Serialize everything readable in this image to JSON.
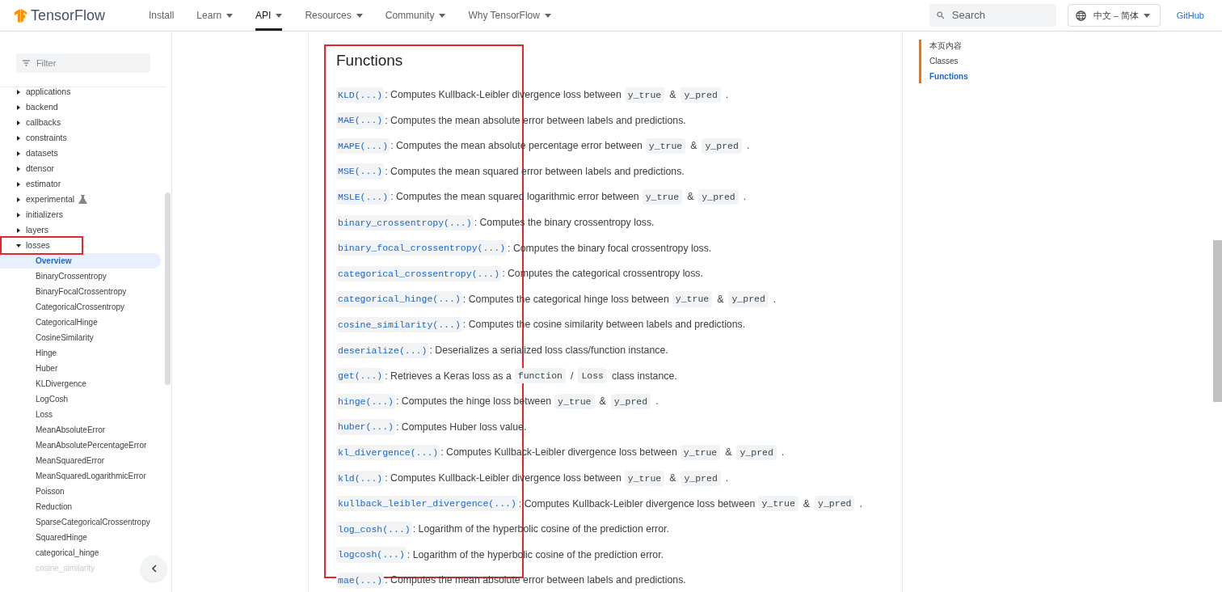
{
  "header": {
    "brand": "TensorFlow",
    "nav": [
      {
        "label": "Install",
        "dropdown": false,
        "selected": false
      },
      {
        "label": "Learn",
        "dropdown": true,
        "selected": false
      },
      {
        "label": "API",
        "dropdown": true,
        "selected": true
      },
      {
        "label": "Resources",
        "dropdown": true,
        "selected": false
      },
      {
        "label": "Community",
        "dropdown": true,
        "selected": false
      },
      {
        "label": "Why TensorFlow",
        "dropdown": true,
        "selected": false
      }
    ],
    "search": {
      "placeholder": "Search"
    },
    "language": "中文 – 简体",
    "github": "GitHub"
  },
  "sidebar": {
    "filter": {
      "placeholder": "Filter"
    },
    "items": [
      {
        "label": "applications",
        "expanded": false,
        "experimental": false,
        "annotated": false
      },
      {
        "label": "backend",
        "expanded": false,
        "experimental": false,
        "annotated": false
      },
      {
        "label": "callbacks",
        "expanded": false,
        "experimental": false,
        "annotated": false
      },
      {
        "label": "constraints",
        "expanded": false,
        "experimental": false,
        "annotated": false
      },
      {
        "label": "datasets",
        "expanded": false,
        "experimental": false,
        "annotated": false
      },
      {
        "label": "dtensor",
        "expanded": false,
        "experimental": false,
        "annotated": false
      },
      {
        "label": "estimator",
        "expanded": false,
        "experimental": false,
        "annotated": false
      },
      {
        "label": "experimental",
        "expanded": false,
        "experimental": true,
        "annotated": false
      },
      {
        "label": "initializers",
        "expanded": false,
        "experimental": false,
        "annotated": false
      },
      {
        "label": "layers",
        "expanded": false,
        "experimental": false,
        "annotated": false
      },
      {
        "label": "losses",
        "expanded": true,
        "experimental": false,
        "annotated": true,
        "children": [
          {
            "label": "Overview",
            "selected": true
          },
          {
            "label": "BinaryCrossentropy",
            "selected": false
          },
          {
            "label": "BinaryFocalCrossentropy",
            "selected": false
          },
          {
            "label": "CategoricalCrossentropy",
            "selected": false
          },
          {
            "label": "CategoricalHinge",
            "selected": false
          },
          {
            "label": "CosineSimilarity",
            "selected": false
          },
          {
            "label": "Hinge",
            "selected": false
          },
          {
            "label": "Huber",
            "selected": false
          },
          {
            "label": "KLDivergence",
            "selected": false
          },
          {
            "label": "LogCosh",
            "selected": false
          },
          {
            "label": "Loss",
            "selected": false
          },
          {
            "label": "MeanAbsoluteError",
            "selected": false
          },
          {
            "label": "MeanAbsolutePercentageError",
            "selected": false
          },
          {
            "label": "MeanSquaredError",
            "selected": false
          },
          {
            "label": "MeanSquaredLogarithmicError",
            "selected": false
          },
          {
            "label": "Poisson",
            "selected": false
          },
          {
            "label": "Reduction",
            "selected": false
          },
          {
            "label": "SparseCategoricalCrossentropy",
            "selected": false
          },
          {
            "label": "SquaredHinge",
            "selected": false
          },
          {
            "label": "categorical_hinge",
            "selected": false
          },
          {
            "label": "cosine_similarity",
            "selected": false
          }
        ]
      }
    ]
  },
  "content": {
    "heading": "Functions",
    "annotated": true,
    "functions": [
      {
        "name": "KLD(...)",
        "parts": [
          {
            "kind": "text",
            "text": ": Computes Kullback-Leibler divergence loss between"
          },
          {
            "kind": "code",
            "text": "y_true"
          },
          {
            "kind": "text",
            "text": "&"
          },
          {
            "kind": "code",
            "text": "y_pred"
          },
          {
            "kind": "text",
            "text": "."
          }
        ]
      },
      {
        "name": "MAE(...)",
        "parts": [
          {
            "kind": "text",
            "text": ": Computes the mean absolute error between labels and predictions."
          }
        ]
      },
      {
        "name": "MAPE(...)",
        "parts": [
          {
            "kind": "text",
            "text": ": Computes the mean absolute percentage error between"
          },
          {
            "kind": "code",
            "text": "y_true"
          },
          {
            "kind": "text",
            "text": "&"
          },
          {
            "kind": "code",
            "text": "y_pred"
          },
          {
            "kind": "text",
            "text": "."
          }
        ]
      },
      {
        "name": "MSE(...)",
        "parts": [
          {
            "kind": "text",
            "text": ": Computes the mean squared error between labels and predictions."
          }
        ]
      },
      {
        "name": "MSLE(...)",
        "parts": [
          {
            "kind": "text",
            "text": ": Computes the mean squared logarithmic error between"
          },
          {
            "kind": "code",
            "text": "y_true"
          },
          {
            "kind": "text",
            "text": "&"
          },
          {
            "kind": "code",
            "text": "y_pred"
          },
          {
            "kind": "text",
            "text": "."
          }
        ]
      },
      {
        "name": "binary_crossentropy(...)",
        "parts": [
          {
            "kind": "text",
            "text": ": Computes the binary crossentropy loss."
          }
        ]
      },
      {
        "name": "binary_focal_crossentropy(...)",
        "parts": [
          {
            "kind": "text",
            "text": ": Computes the binary focal crossentropy loss."
          }
        ]
      },
      {
        "name": "categorical_crossentropy(...)",
        "parts": [
          {
            "kind": "text",
            "text": ": Computes the categorical crossentropy loss."
          }
        ]
      },
      {
        "name": "categorical_hinge(...)",
        "parts": [
          {
            "kind": "text",
            "text": ": Computes the categorical hinge loss between"
          },
          {
            "kind": "code",
            "text": "y_true"
          },
          {
            "kind": "text",
            "text": "&"
          },
          {
            "kind": "code",
            "text": "y_pred"
          },
          {
            "kind": "text",
            "text": "."
          }
        ]
      },
      {
        "name": "cosine_similarity(...)",
        "parts": [
          {
            "kind": "text",
            "text": ": Computes the cosine similarity between labels and predictions."
          }
        ]
      },
      {
        "name": "deserialize(...)",
        "parts": [
          {
            "kind": "text",
            "text": ": Deserializes a serialized loss class/function instance."
          }
        ]
      },
      {
        "name": "get(...)",
        "parts": [
          {
            "kind": "text",
            "text": ": Retrieves a Keras loss as a"
          },
          {
            "kind": "code",
            "text": "function"
          },
          {
            "kind": "text",
            "text": "/"
          },
          {
            "kind": "code",
            "text": "Loss"
          },
          {
            "kind": "text",
            "text": "class instance."
          }
        ]
      },
      {
        "name": "hinge(...)",
        "parts": [
          {
            "kind": "text",
            "text": ": Computes the hinge loss between"
          },
          {
            "kind": "code",
            "text": "y_true"
          },
          {
            "kind": "text",
            "text": "&"
          },
          {
            "kind": "code",
            "text": "y_pred"
          },
          {
            "kind": "text",
            "text": "."
          }
        ]
      },
      {
        "name": "huber(...)",
        "parts": [
          {
            "kind": "text",
            "text": ": Computes Huber loss value."
          }
        ]
      },
      {
        "name": "kl_divergence(...)",
        "parts": [
          {
            "kind": "text",
            "text": ": Computes Kullback-Leibler divergence loss between"
          },
          {
            "kind": "code",
            "text": "y_true"
          },
          {
            "kind": "text",
            "text": "&"
          },
          {
            "kind": "code",
            "text": "y_pred"
          },
          {
            "kind": "text",
            "text": "."
          }
        ]
      },
      {
        "name": "kld(...)",
        "parts": [
          {
            "kind": "text",
            "text": ": Computes Kullback-Leibler divergence loss between"
          },
          {
            "kind": "code",
            "text": "y_true"
          },
          {
            "kind": "text",
            "text": "&"
          },
          {
            "kind": "code",
            "text": "y_pred"
          },
          {
            "kind": "text",
            "text": "."
          }
        ]
      },
      {
        "name": "kullback_leibler_divergence(...)",
        "parts": [
          {
            "kind": "text",
            "text": ": Computes Kullback-Leibler divergence loss between"
          },
          {
            "kind": "code",
            "text": "y_true"
          },
          {
            "kind": "text",
            "text": "&"
          },
          {
            "kind": "code",
            "text": "y_pred"
          },
          {
            "kind": "text",
            "text": "."
          }
        ]
      },
      {
        "name": "log_cosh(...)",
        "parts": [
          {
            "kind": "text",
            "text": ": Logarithm of the hyperbolic cosine of the prediction error."
          }
        ]
      },
      {
        "name": "logcosh(...)",
        "parts": [
          {
            "kind": "text",
            "text": ": Logarithm of the hyperbolic cosine of the prediction error."
          }
        ]
      },
      {
        "name": "mae(...)",
        "parts": [
          {
            "kind": "text",
            "text": ": Computes the mean absolute error between labels and predictions."
          }
        ]
      }
    ]
  },
  "toc": {
    "items": [
      {
        "label": "本页内容",
        "selected": false
      },
      {
        "label": "Classes",
        "selected": false
      },
      {
        "label": "Functions",
        "selected": true
      }
    ]
  }
}
